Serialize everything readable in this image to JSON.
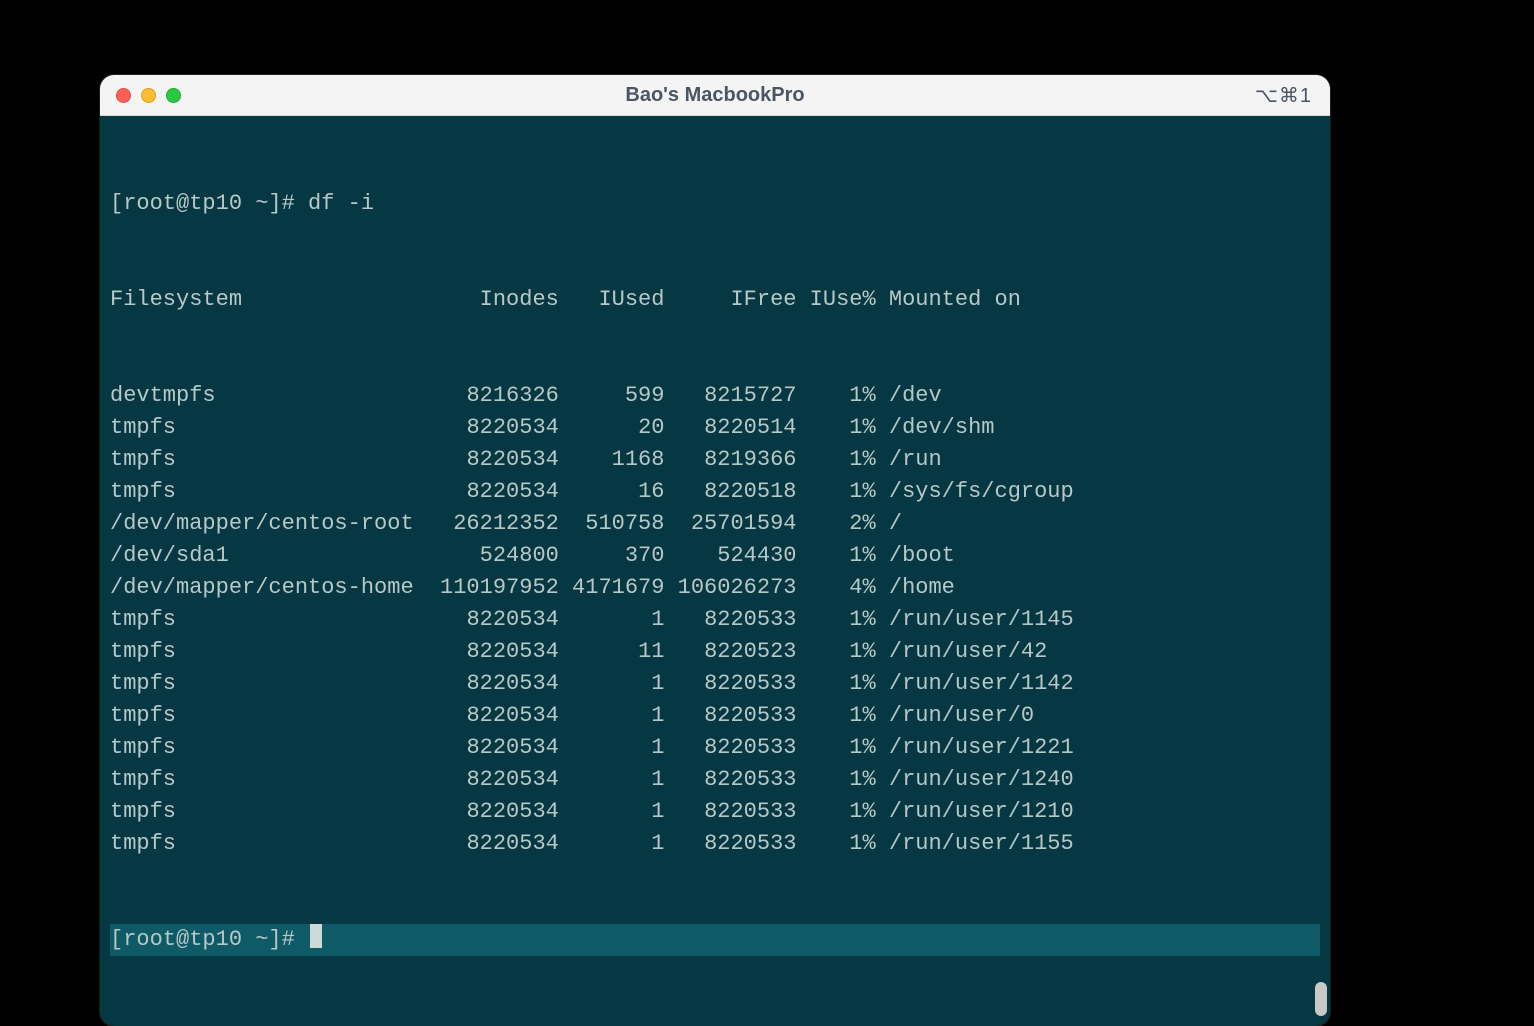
{
  "window": {
    "title": "Bao's MacbookPro",
    "shortcut": "⌥⌘1"
  },
  "prompt1": "[root@tp10 ~]# ",
  "command": "df -i",
  "header": {
    "fs": "Filesystem",
    "inodes": "Inodes",
    "iused": "IUsed",
    "ifree": "IFree",
    "ipct": "IUse%",
    "mnt": "Mounted on"
  },
  "rows": [
    {
      "fs": "devtmpfs",
      "inodes": "8216326",
      "iused": "599",
      "ifree": "8215727",
      "ipct": "1%",
      "mnt": "/dev"
    },
    {
      "fs": "tmpfs",
      "inodes": "8220534",
      "iused": "20",
      "ifree": "8220514",
      "ipct": "1%",
      "mnt": "/dev/shm"
    },
    {
      "fs": "tmpfs",
      "inodes": "8220534",
      "iused": "1168",
      "ifree": "8219366",
      "ipct": "1%",
      "mnt": "/run"
    },
    {
      "fs": "tmpfs",
      "inodes": "8220534",
      "iused": "16",
      "ifree": "8220518",
      "ipct": "1%",
      "mnt": "/sys/fs/cgroup"
    },
    {
      "fs": "/dev/mapper/centos-root",
      "inodes": "26212352",
      "iused": "510758",
      "ifree": "25701594",
      "ipct": "2%",
      "mnt": "/"
    },
    {
      "fs": "/dev/sda1",
      "inodes": "524800",
      "iused": "370",
      "ifree": "524430",
      "ipct": "1%",
      "mnt": "/boot"
    },
    {
      "fs": "/dev/mapper/centos-home",
      "inodes": "110197952",
      "iused": "4171679",
      "ifree": "106026273",
      "ipct": "4%",
      "mnt": "/home"
    },
    {
      "fs": "tmpfs",
      "inodes": "8220534",
      "iused": "1",
      "ifree": "8220533",
      "ipct": "1%",
      "mnt": "/run/user/1145"
    },
    {
      "fs": "tmpfs",
      "inodes": "8220534",
      "iused": "11",
      "ifree": "8220523",
      "ipct": "1%",
      "mnt": "/run/user/42"
    },
    {
      "fs": "tmpfs",
      "inodes": "8220534",
      "iused": "1",
      "ifree": "8220533",
      "ipct": "1%",
      "mnt": "/run/user/1142"
    },
    {
      "fs": "tmpfs",
      "inodes": "8220534",
      "iused": "1",
      "ifree": "8220533",
      "ipct": "1%",
      "mnt": "/run/user/0"
    },
    {
      "fs": "tmpfs",
      "inodes": "8220534",
      "iused": "1",
      "ifree": "8220533",
      "ipct": "1%",
      "mnt": "/run/user/1221"
    },
    {
      "fs": "tmpfs",
      "inodes": "8220534",
      "iused": "1",
      "ifree": "8220533",
      "ipct": "1%",
      "mnt": "/run/user/1240"
    },
    {
      "fs": "tmpfs",
      "inodes": "8220534",
      "iused": "1",
      "ifree": "8220533",
      "ipct": "1%",
      "mnt": "/run/user/1210"
    },
    {
      "fs": "tmpfs",
      "inodes": "8220534",
      "iused": "1",
      "ifree": "8220533",
      "ipct": "1%",
      "mnt": "/run/user/1155"
    }
  ],
  "prompt2": "[root@tp10 ~]# "
}
